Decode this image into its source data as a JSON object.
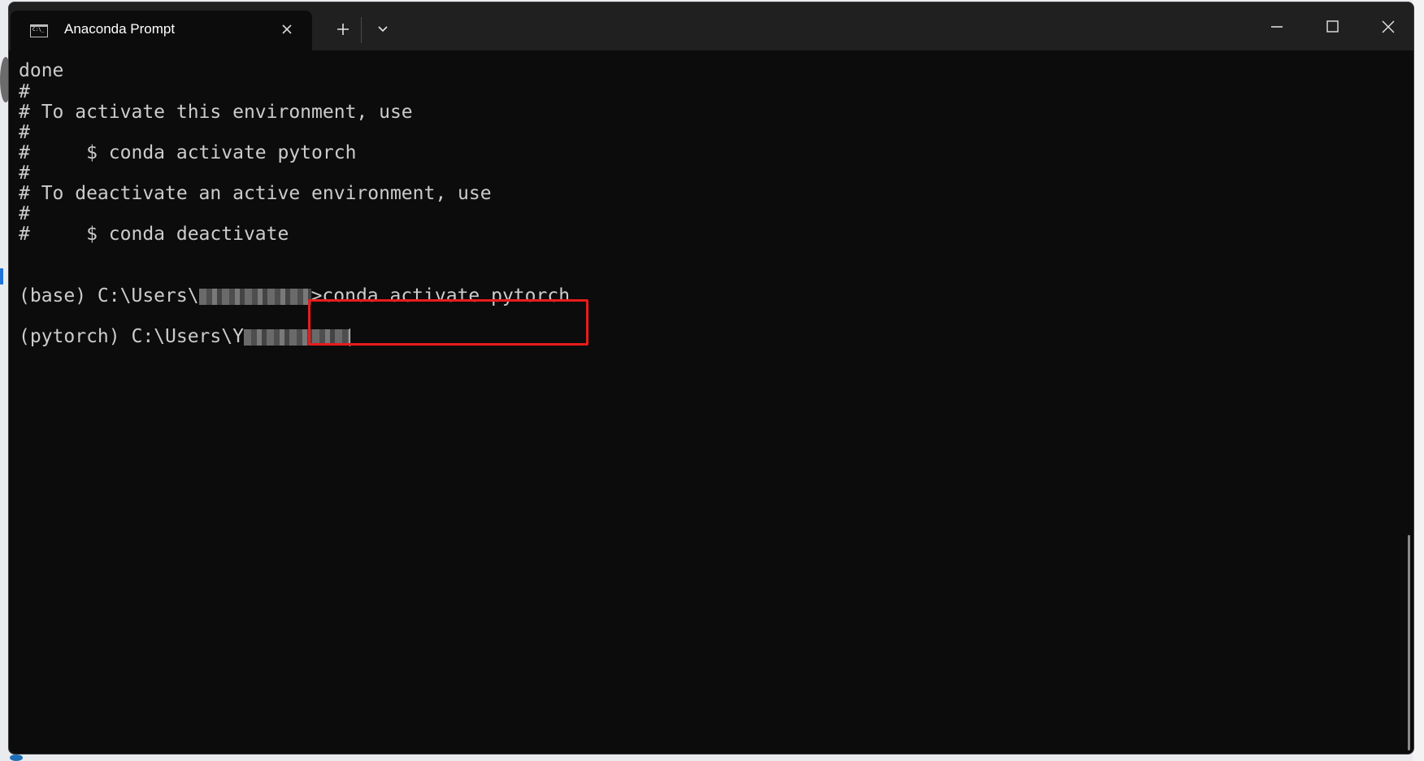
{
  "window": {
    "tab_title": "Anaconda Prompt",
    "tab_icon": "terminal-icon",
    "close_tab_icon": "close-icon",
    "new_tab_icon": "plus-icon",
    "dropdown_icon": "chevron-down-icon",
    "controls": [
      "minimize-icon",
      "maximize-icon",
      "close-icon"
    ]
  },
  "terminal": {
    "lines": [
      "done",
      "#",
      "# To activate this environment, use",
      "#",
      "#     $ conda activate pytorch",
      "#",
      "# To deactivate an active environment, use",
      "#",
      "#     $ conda deactivate"
    ],
    "prompt1": {
      "prefix": "(base) C:\\Users\\",
      "command": ">conda activate pytorch"
    },
    "prompt2": {
      "prefix": "(pytorch) C:\\Users\\Y"
    }
  },
  "colors": {
    "background": "#0c0c0c",
    "text": "#cccccc",
    "titlebar": "#202020",
    "highlight": "#e81c1c"
  }
}
